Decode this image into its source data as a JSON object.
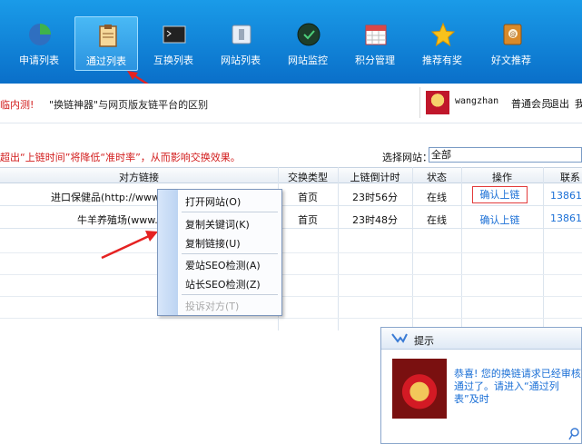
{
  "toolbar": {
    "items": [
      {
        "label": "申请列表",
        "icon": "pie-chart-icon"
      },
      {
        "label": "通过列表",
        "icon": "clipboard-icon",
        "active": true
      },
      {
        "label": "互换列表",
        "icon": "terminal-icon"
      },
      {
        "label": "网站列表",
        "icon": "window-icon"
      },
      {
        "label": "网站监控",
        "icon": "monitor-globe-icon"
      },
      {
        "label": "积分管理",
        "icon": "calendar-icon"
      },
      {
        "label": "推荐有奖",
        "icon": "star-icon"
      },
      {
        "label": "好文推荐",
        "icon": "address-book-icon"
      }
    ]
  },
  "info": {
    "notice_red": "临内测!",
    "notice_black": "\"换链神器\"与网页版友链平台的区别",
    "username": "wangzhan",
    "member_type": "普通会员",
    "logout": "退出",
    "more": "我"
  },
  "warning": "超出“上链时间”将降低“准时率”，从而影响交换效果。",
  "site_select": {
    "label": "选择网站：",
    "value": "全部"
  },
  "table": {
    "headers": [
      "对方链接",
      "交换类型",
      "上链倒计时",
      "状态",
      "操作",
      "联系"
    ],
    "rows": [
      {
        "link": "进口保健品(http://www",
        "type": "首页",
        "countdown": "23时56分",
        "status": "在线",
        "action": "确认上链",
        "contact": "13861"
      },
      {
        "link": "牛羊养殖场(www.n",
        "type": "首页",
        "countdown": "23时48分",
        "status": "在线",
        "action": "确认上链",
        "contact": "13861"
      }
    ]
  },
  "context_menu": {
    "items": [
      {
        "label": "打开网站(O)",
        "enabled": true
      },
      {
        "label": "复制关键词(K)",
        "enabled": true
      },
      {
        "label": "复制链接(U)",
        "enabled": true
      },
      {
        "label": "爱站SEO检测(A)",
        "enabled": true
      },
      {
        "label": "站长SEO检测(Z)",
        "enabled": true
      },
      {
        "label": "投诉对方(T)",
        "enabled": false
      }
    ]
  },
  "popup": {
    "title": "提示",
    "message": "恭喜! 您的换链请求已经审核通过了。请进入“通过列表”及时"
  },
  "colors": {
    "toolbar": "#0a6fc9",
    "accent": "#d21c1c",
    "link": "#1a6fd6"
  }
}
